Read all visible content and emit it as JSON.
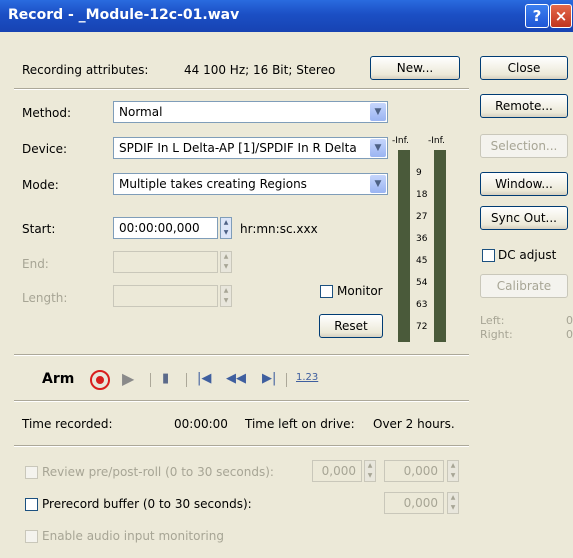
{
  "window": {
    "title": "Record - _Module-12c-01.wav"
  },
  "attributes": {
    "label": "Recording attributes:",
    "value": "44 100 Hz; 16 Bit; Stereo"
  },
  "buttons": {
    "new": "New...",
    "close": "Close",
    "remote": "Remote...",
    "selection": "Selection...",
    "window": "Window...",
    "sync_out": "Sync Out...",
    "calibrate": "Calibrate",
    "reset": "Reset"
  },
  "method": {
    "label": "Method:",
    "value": "Normal"
  },
  "device": {
    "label": "Device:",
    "value": "SPDIF In L Delta-AP [1]/SPDIF In R Delta"
  },
  "mode": {
    "label": "Mode:",
    "value": "Multiple takes creating Regions"
  },
  "start": {
    "label": "Start:",
    "value": "00:00:00,000",
    "format": "hr:mn:sc.xxx"
  },
  "end": {
    "label": "End:"
  },
  "length": {
    "label": "Length:"
  },
  "monitor": {
    "label": "Monitor"
  },
  "meter": {
    "left_peak": "-Inf.",
    "right_peak": "-Inf.",
    "scale": [
      "9",
      "18",
      "27",
      "36",
      "45",
      "54",
      "63",
      "72"
    ]
  },
  "dc_adjust": {
    "label": "DC adjust"
  },
  "levels": {
    "left_label": "Left:",
    "left_value": "0",
    "right_label": "Right:",
    "right_value": "0"
  },
  "transport": {
    "arm": "Arm",
    "counter": "1.23"
  },
  "status": {
    "time_recorded_label": "Time recorded:",
    "time_recorded": "00:00:00",
    "time_left_label": "Time left on drive:",
    "time_left": "Over 2 hours."
  },
  "options": {
    "review_label": "Review pre/post-roll (0 to 30 seconds):",
    "review_pre": "0,000",
    "review_post": "0,000",
    "prerecord_label": "Prerecord buffer (0 to 30 seconds):",
    "prerecord_value": "0,000",
    "monitoring_label": "Enable audio input monitoring"
  }
}
